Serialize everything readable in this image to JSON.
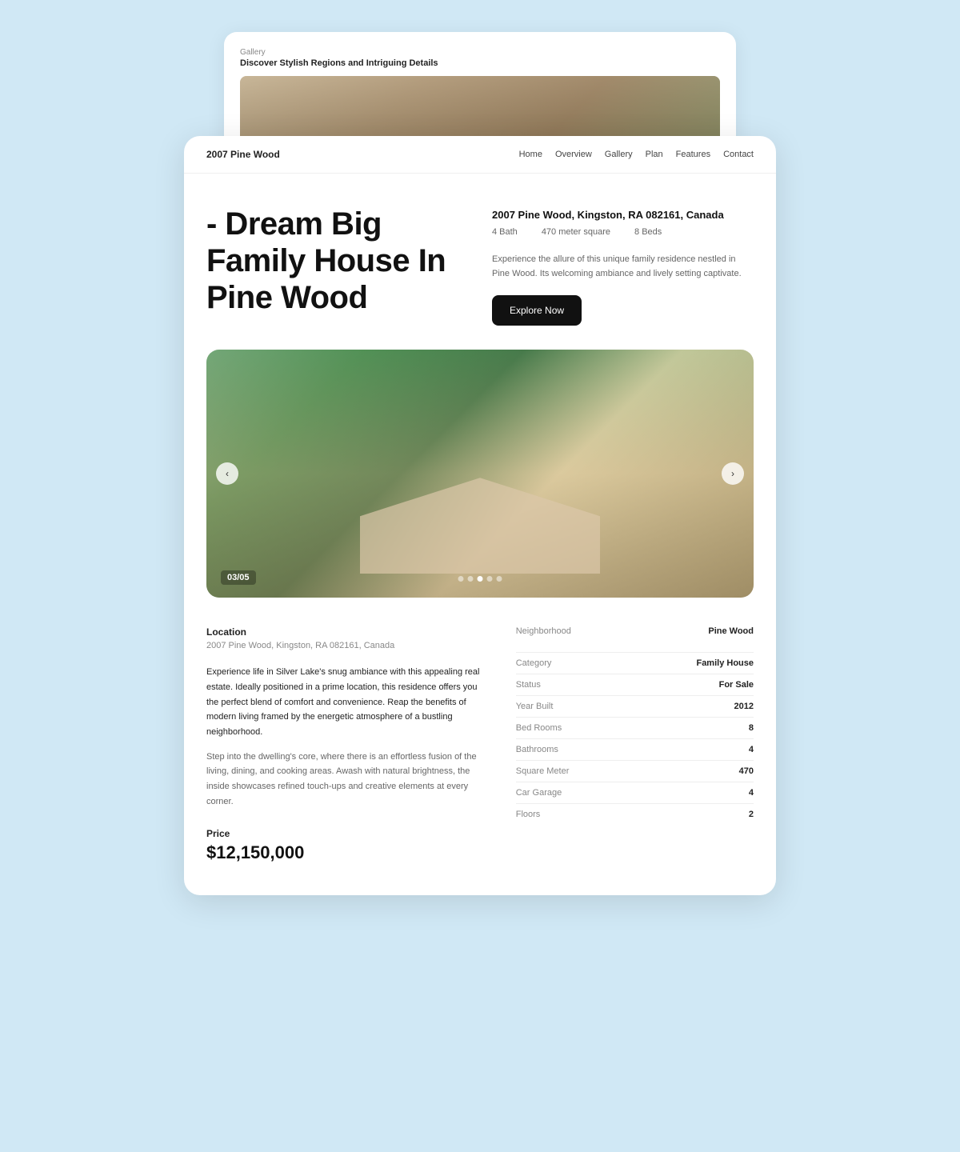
{
  "background_card": {
    "label": "Gallery",
    "title": "Discover Stylish Regions and Intriguing Details"
  },
  "nav": {
    "brand": "2007 Pine Wood",
    "links": [
      "Home",
      "Overview",
      "Gallery",
      "Plan",
      "Features",
      "Contact"
    ]
  },
  "hero": {
    "title": "- Dream Big Family House In Pine Wood",
    "address": "2007 Pine Wood, Kingston, RA 082161, Canada",
    "stats": {
      "bath": "4 Bath",
      "size": "470 meter square",
      "beds": "8 Beds"
    },
    "description": "Experience the allure of this unique family residence nestled in Pine Wood. Its welcoming ambiance and lively setting captivate.",
    "cta_label": "Explore Now"
  },
  "carousel": {
    "counter": "03/05",
    "total": 5,
    "active_dot": 2,
    "dots": [
      0,
      1,
      2,
      3,
      4
    ]
  },
  "details": {
    "location_label": "Location",
    "location_address": "2007 Pine Wood, Kingston, RA 082161, Canada",
    "description_1": "Experience life in Silver Lake's snug ambiance with this appealing real estate. Ideally positioned in a prime location, this residence offers you the perfect blend of comfort and convenience. Reap the benefits of modern living framed by the energetic atmosphere of a bustling neighborhood.",
    "description_2": "Step into the dwelling's core, where there is an effortless fusion of the living, dining, and cooking areas. Awash with natural brightness, the inside showcases refined touch-ups and creative elements at every corner.",
    "price_label": "Price",
    "price": "$12,150,000",
    "neighborhood_label": "Neighborhood",
    "neighborhood_value": "Pine Wood",
    "specs": [
      {
        "label": "Category",
        "value": "Family House"
      },
      {
        "label": "Status",
        "value": "For Sale"
      },
      {
        "label": "Year Built",
        "value": "2012"
      },
      {
        "label": "Bed Rooms",
        "value": "8"
      },
      {
        "label": "Bathrooms",
        "value": "4"
      },
      {
        "label": "Square Meter",
        "value": "470"
      },
      {
        "label": "Car Garage",
        "value": "4"
      },
      {
        "label": "Floors",
        "value": "2"
      }
    ]
  }
}
